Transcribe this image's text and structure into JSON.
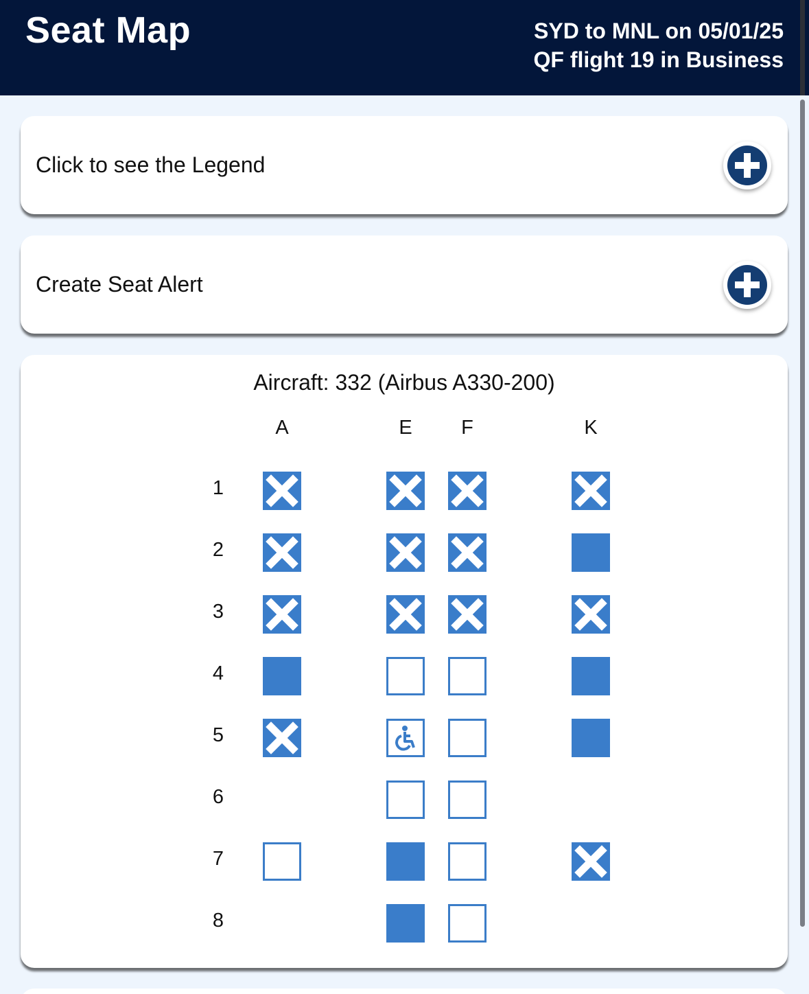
{
  "header": {
    "title": "Seat Map",
    "route": "SYD to MNL on 05/01/25",
    "flight": "QF flight 19 in Business"
  },
  "legend": {
    "label": "Click to see the Legend"
  },
  "alert": {
    "label": "Create Seat Alert"
  },
  "map": {
    "aircraft": "Aircraft: 332 (Airbus A330-200)",
    "columns": [
      "A",
      "E",
      "F",
      "K"
    ],
    "rows": [
      {
        "number": "1",
        "seats": [
          "blocked",
          "blocked",
          "blocked",
          "blocked"
        ]
      },
      {
        "number": "2",
        "seats": [
          "blocked",
          "blocked",
          "blocked",
          "occupied"
        ]
      },
      {
        "number": "3",
        "seats": [
          "blocked",
          "blocked",
          "blocked",
          "blocked"
        ]
      },
      {
        "number": "4",
        "seats": [
          "occupied",
          "available",
          "available",
          "occupied"
        ]
      },
      {
        "number": "5",
        "seats": [
          "blocked",
          "accessible",
          "available",
          "occupied"
        ]
      },
      {
        "number": "6",
        "seats": [
          "none",
          "available",
          "available",
          "none"
        ]
      },
      {
        "number": "7",
        "seats": [
          "available",
          "occupied",
          "available",
          "blocked"
        ]
      },
      {
        "number": "8",
        "seats": [
          "none",
          "occupied",
          "available",
          "none"
        ]
      }
    ]
  },
  "colors": {
    "header_bg": "#03163a",
    "seat_blue": "#3a7dca",
    "button_navy": "#143d72"
  }
}
